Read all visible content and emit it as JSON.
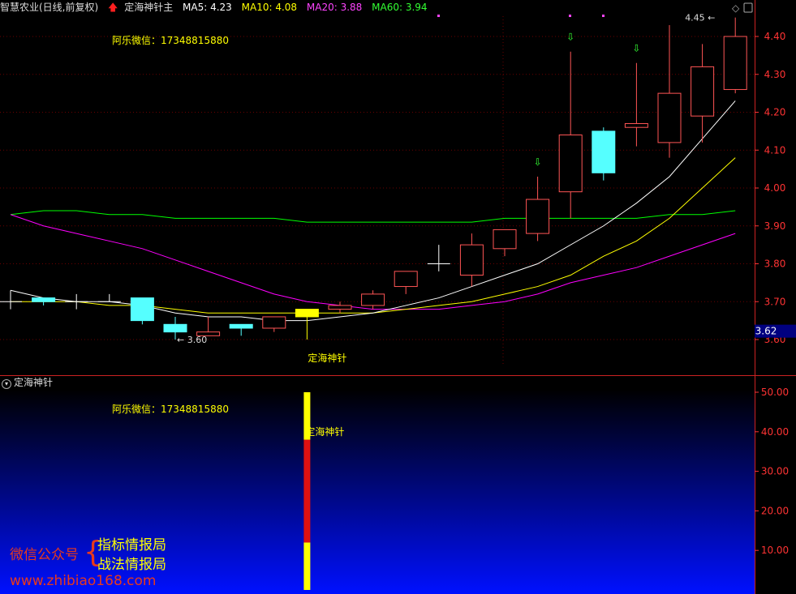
{
  "header": {
    "stock_name": "智慧农业(日线,前复权)",
    "indicator_name": "定海神针主",
    "ma5": "MA5: 4.23",
    "ma10": "MA10: 4.08",
    "ma20": "MA20: 3.88",
    "ma60": "MA60: 3.94"
  },
  "colors": {
    "ma5": "#ffffff",
    "ma10": "#ffff00",
    "ma20": "#ff00ff",
    "ma60": "#00ff00",
    "up": "#ff5555",
    "down": "#55ffff",
    "axis": "#ff3333",
    "grid": "#6a0000",
    "price_tag": "#000080"
  },
  "main_chart": {
    "contact_label": "阿乐微信：17348815880",
    "marker_label": "定海神针",
    "high_label": "4.45",
    "low_label": "3.60",
    "current_price": "3.62",
    "y_ticks": [
      "4.40",
      "4.30",
      "4.20",
      "4.10",
      "4.00",
      "3.90",
      "3.80",
      "3.70",
      "3.60"
    ],
    "y_tick_values": [
      4.4,
      4.3,
      4.2,
      4.1,
      4.0,
      3.9,
      3.8,
      3.7,
      3.6
    ],
    "candles": [
      {
        "o": 3.7,
        "h": 3.73,
        "l": 3.68,
        "c": 3.7
      },
      {
        "o": 3.71,
        "h": 3.71,
        "l": 3.69,
        "c": 3.7
      },
      {
        "o": 3.7,
        "h": 3.72,
        "l": 3.68,
        "c": 3.7
      },
      {
        "o": 3.7,
        "h": 3.72,
        "l": 3.7,
        "c": 3.7
      },
      {
        "o": 3.71,
        "h": 3.71,
        "l": 3.64,
        "c": 3.65
      },
      {
        "o": 3.64,
        "h": 3.66,
        "l": 3.6,
        "c": 3.62
      },
      {
        "o": 3.61,
        "h": 3.66,
        "l": 3.61,
        "c": 3.62
      },
      {
        "o": 3.64,
        "h": 3.64,
        "l": 3.61,
        "c": 3.63
      },
      {
        "o": 3.63,
        "h": 3.66,
        "l": 3.62,
        "c": 3.66
      },
      {
        "o": 3.66,
        "h": 3.68,
        "l": 3.6,
        "c": 3.68
      },
      {
        "o": 3.68,
        "h": 3.7,
        "l": 3.67,
        "c": 3.69
      },
      {
        "o": 3.69,
        "h": 3.73,
        "l": 3.68,
        "c": 3.72
      },
      {
        "o": 3.74,
        "h": 3.78,
        "l": 3.72,
        "c": 3.78
      },
      {
        "o": 3.8,
        "h": 3.85,
        "l": 3.78,
        "c": 3.8
      },
      {
        "o": 3.77,
        "h": 3.88,
        "l": 3.74,
        "c": 3.85
      },
      {
        "o": 3.84,
        "h": 3.89,
        "l": 3.82,
        "c": 3.89
      },
      {
        "o": 3.88,
        "h": 4.03,
        "l": 3.86,
        "c": 3.97
      },
      {
        "o": 3.99,
        "h": 4.36,
        "l": 3.92,
        "c": 4.14
      },
      {
        "o": 4.15,
        "h": 4.16,
        "l": 4.02,
        "c": 4.04
      },
      {
        "o": 4.16,
        "h": 4.33,
        "l": 4.11,
        "c": 4.17
      },
      {
        "o": 4.12,
        "h": 4.43,
        "l": 4.08,
        "c": 4.25
      },
      {
        "o": 4.19,
        "h": 4.38,
        "l": 4.12,
        "c": 4.32
      },
      {
        "o": 4.26,
        "h": 4.45,
        "l": 4.25,
        "c": 4.4
      }
    ],
    "ma5_values": [
      3.73,
      3.71,
      3.7,
      3.7,
      3.69,
      3.67,
      3.66,
      3.66,
      3.65,
      3.65,
      3.66,
      3.67,
      3.69,
      3.71,
      3.74,
      3.77,
      3.8,
      3.85,
      3.9,
      3.96,
      4.03,
      4.13,
      4.23
    ],
    "ma10_values": [
      3.7,
      3.7,
      3.7,
      3.69,
      3.69,
      3.68,
      3.67,
      3.67,
      3.67,
      3.67,
      3.67,
      3.67,
      3.68,
      3.69,
      3.7,
      3.72,
      3.74,
      3.77,
      3.82,
      3.86,
      3.92,
      4.0,
      4.08
    ],
    "ma20_values": [
      3.93,
      3.9,
      3.88,
      3.86,
      3.84,
      3.81,
      3.78,
      3.75,
      3.72,
      3.7,
      3.69,
      3.68,
      3.68,
      3.68,
      3.69,
      3.7,
      3.72,
      3.75,
      3.77,
      3.79,
      3.82,
      3.85,
      3.88
    ],
    "ma60_values": [
      3.93,
      3.94,
      3.94,
      3.93,
      3.93,
      3.92,
      3.92,
      3.92,
      3.92,
      3.91,
      3.91,
      3.91,
      3.91,
      3.91,
      3.91,
      3.92,
      3.92,
      3.92,
      3.92,
      3.92,
      3.93,
      3.93,
      3.94
    ],
    "down_arrow_bars": [
      16,
      17,
      19
    ],
    "signal_bar": 9
  },
  "sub_chart": {
    "title": "定海神针",
    "contact_label": "阿乐微信：17348815880",
    "marker_label": "定海神针",
    "y_ticks": [
      "50.00",
      "40.00",
      "30.00",
      "20.00",
      "10.00"
    ],
    "y_tick_values": [
      50,
      40,
      30,
      20,
      10
    ],
    "bar_segments": [
      {
        "from": 0,
        "to": 12,
        "color": "#ffff00"
      },
      {
        "from": 12,
        "to": 38,
        "color": "#dd1111"
      },
      {
        "from": 38,
        "to": 50,
        "color": "#ffff00"
      }
    ]
  },
  "watermark": {
    "wechat_label": "微信公众号",
    "brace": "{",
    "line1": "指标情报局",
    "line2": "战法情报局",
    "url": "www.zhibiao168.com"
  }
}
